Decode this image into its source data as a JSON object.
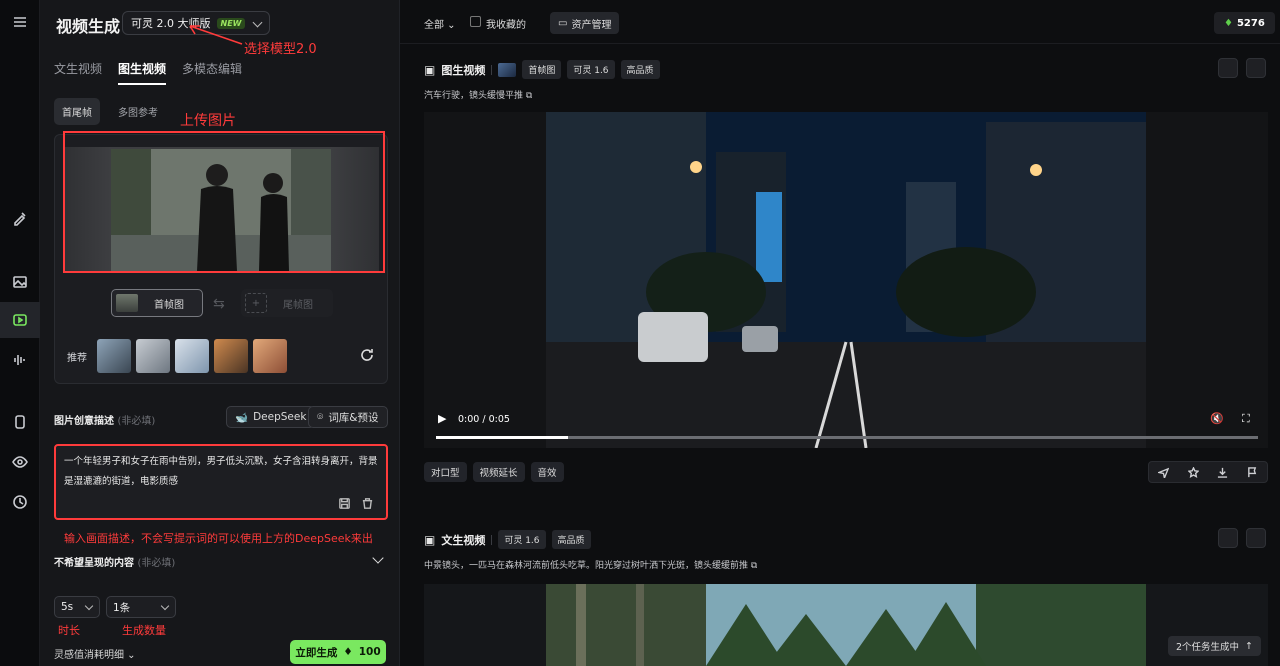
{
  "panel": {
    "title": "视频生成",
    "model": {
      "name": "可灵 2.0 大师版",
      "badge": "NEW"
    },
    "annotation_model": "选择模型2.0",
    "tabs": [
      {
        "label": "文生视频",
        "active": false
      },
      {
        "label": "图生视频",
        "active": true
      },
      {
        "label": "多模态编辑",
        "active": false
      }
    ],
    "subtabs": [
      {
        "label": "首尾帧",
        "active": true
      },
      {
        "label": "多图参考",
        "active": false
      }
    ],
    "annotation_upload": "上传图片",
    "first_frame_label": "首帧图",
    "last_frame_label": "尾帧图",
    "recommend_label": "推荐",
    "desc_label": "图片创意描述",
    "optional": "(非必填)",
    "deepseek_label": "DeepSeek",
    "preset_label": "词库&预设",
    "prompt_text": "一个年轻男子和女子在雨中告别，男子低头沉默，女子含泪转身离开，背景是湿漉漉的街道，电影质感",
    "annotation_prompt": "输入画面描述，不会写提示词的可以使用上方的DeepSeek来出",
    "negative_label": "不希望呈现的内容",
    "negative_optional": "(非必填)",
    "duration_value": "5s",
    "count_value": "1条",
    "annotation_duration": "时长",
    "annotation_count": "生成数量",
    "cost_detail_label": "灵感值消耗明细",
    "generate_label": "立即生成",
    "generate_cost": "100"
  },
  "topbar": {
    "filter_label": "全部",
    "favorites_label": "我收藏的",
    "assets_label": "资产管理",
    "points": "5276"
  },
  "cards": [
    {
      "title": "图生视频",
      "tags": [
        "首帧图",
        "可灵 1.6",
        "高品质"
      ],
      "prompt": "汽车行驶，镜头缓慢平推",
      "time": "0:00 / 0:05",
      "progress": 0.16,
      "actions": [
        "对口型",
        "视频延长",
        "音效"
      ]
    },
    {
      "title": "文生视频",
      "tags": [
        "可灵 1.6",
        "高品质"
      ],
      "prompt": "中景镜头，一匹马在森林河流前低头吃草。阳光穿过树叶洒下光斑，镜头缓缓前推"
    }
  ],
  "task_status": "2个任务生成中",
  "colors": {
    "accent_green": "#7ae860",
    "annotation_red": "#ff3b3b"
  }
}
